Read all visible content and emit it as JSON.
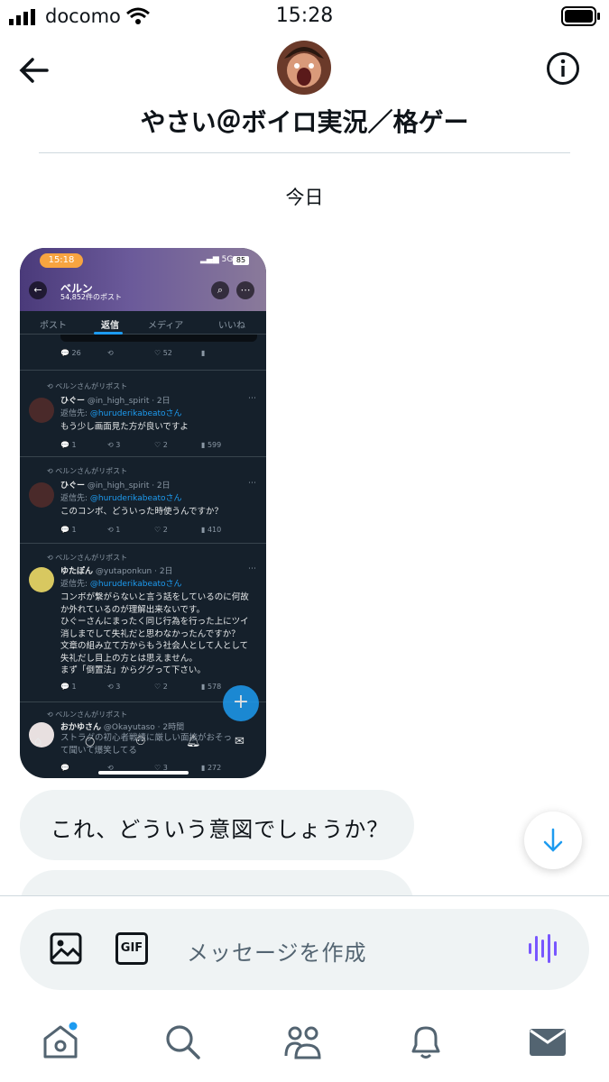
{
  "status_bar": {
    "carrier": "docomo",
    "time": "15:28"
  },
  "header": {
    "back_icon": "arrow-left-icon",
    "info_icon": "info-icon",
    "title": "やさい＠ボイロ実況／格ゲー"
  },
  "conversation": {
    "date_label": "今日",
    "attachment": {
      "status_time": "15:18",
      "network": "5G",
      "battery": "85",
      "profile_name": "ベルン",
      "profile_posts": "54,852件のポスト",
      "tabs": [
        "ポスト",
        "返信",
        "メディア",
        "いいね"
      ],
      "top_post_actions": [
        "26",
        "",
        "52",
        "",
        ""
      ],
      "posts": [
        {
          "repost_label": "ベルンさんがリポスト",
          "name": "ひぐー",
          "handle": "@in_high_spirit · 2日",
          "reply_to_prefix": "返信先: ",
          "reply_to": "@huruderikabeato",
          "reply_to_suffix": "さん",
          "text": "もう少し画面見た方が良いですよ",
          "actions": [
            "1",
            "3",
            "2",
            "599",
            ""
          ]
        },
        {
          "repost_label": "ベルンさんがリポスト",
          "name": "ひぐー",
          "handle": "@in_high_spirit · 2日",
          "reply_to_prefix": "返信先: ",
          "reply_to": "@huruderikabeato",
          "reply_to_suffix": "さん",
          "text": "このコンボ、どういった時使うんですか？",
          "actions": [
            "1",
            "1",
            "2",
            "410",
            ""
          ]
        },
        {
          "repost_label": "ベルンさんがリポスト",
          "name": "ゆたぽん",
          "handle": "@yutaponkun · 2日",
          "reply_to_prefix": "返信先: ",
          "reply_to": "@huruderikabeato",
          "reply_to_suffix": "さん",
          "text_lines": [
            "コンボが繋がらないと言う話をしているのに何故",
            "か外れているのが理解出来ないです。",
            "ひぐーさんにまったく同じ行為を行った上にツイ",
            "消しまでして失礼だと思わなかったんですか？",
            "文章の組み立て方からもう社会人として人として",
            "失礼だし目上の方とは思えません。",
            "まず「倒置法」からググって下さい。"
          ],
          "actions": [
            "1",
            "3",
            "2",
            "578",
            ""
          ]
        },
        {
          "repost_label": "ベルンさんがリポスト",
          "name": "おかゆさん",
          "handle": "@Okayutaso · 2時間",
          "text_lines": [
            "ストラグの初心者戦績に厳しい面接がおそっ",
            "て聞いて爆笑してる"
          ],
          "actions": [
            "",
            "",
            "3",
            "272",
            ""
          ]
        }
      ]
    },
    "messages": [
      {
        "text": "これ、どういう意図でしょうか？"
      },
      {
        "text": ""
      }
    ],
    "scroll_down_icon": "arrow-down-icon"
  },
  "composer": {
    "image_icon": "image-icon",
    "gif_label": "GIF",
    "placeholder": "メッセージを作成",
    "voice_icon": "voice-waveform-icon"
  },
  "bottom_nav": {
    "items": [
      "home-icon",
      "search-icon",
      "communities-icon",
      "notifications-icon",
      "messages-icon"
    ],
    "accent": "#1d9bf0"
  }
}
